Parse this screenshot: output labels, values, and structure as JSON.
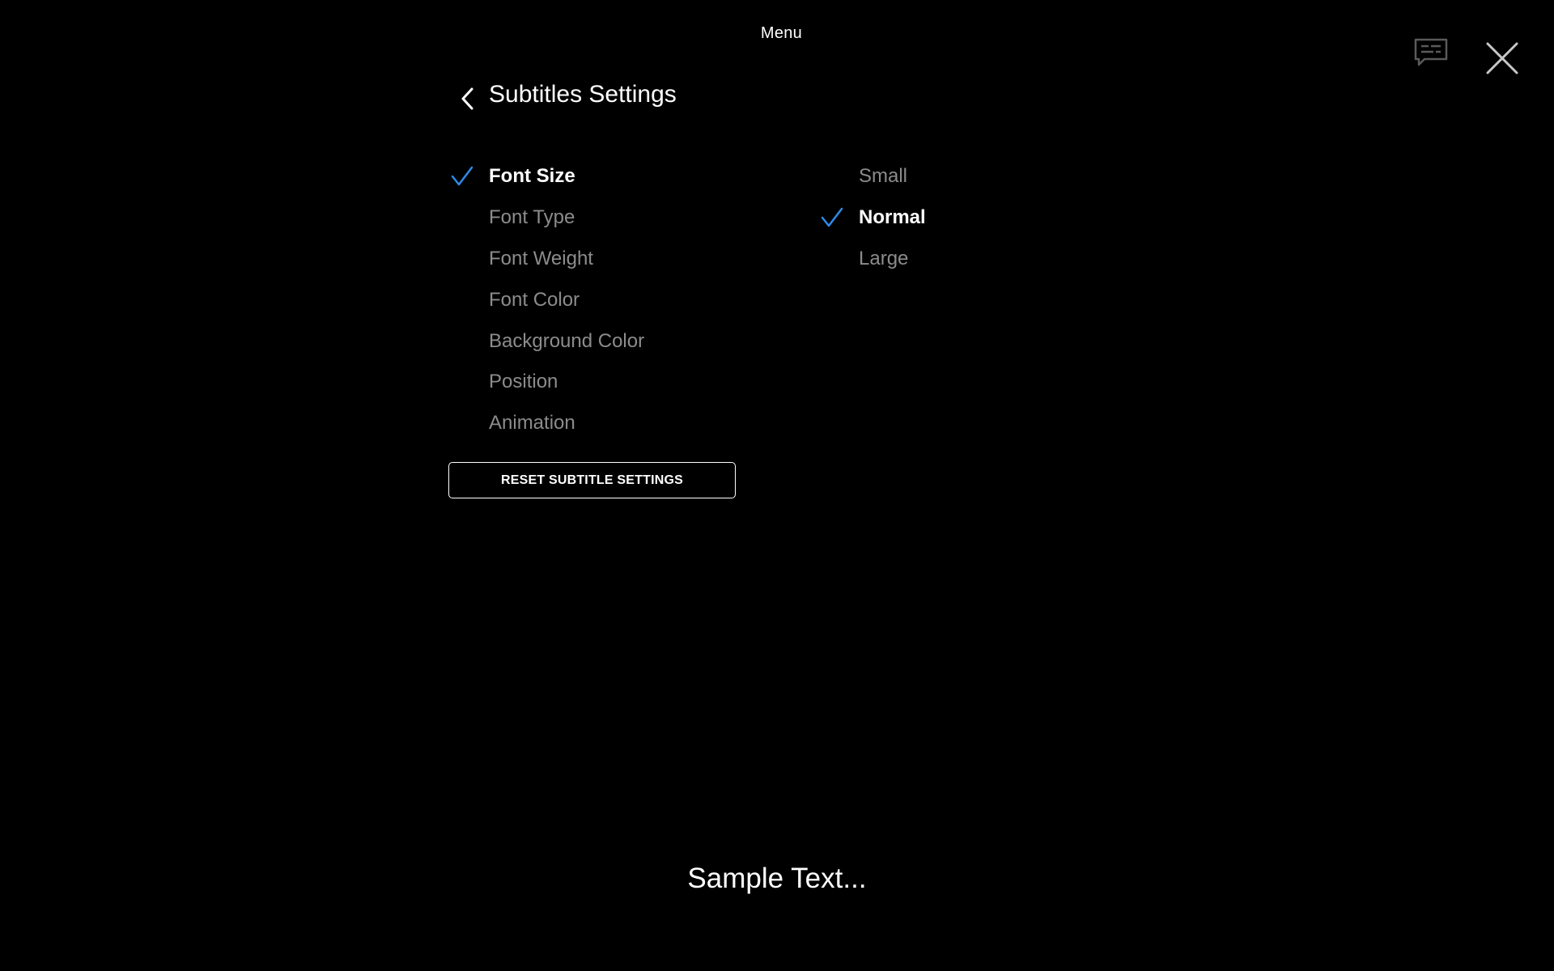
{
  "header": {
    "menu_title": "Menu",
    "subtitles_icon": "subtitles-icon",
    "close_icon": "close-icon"
  },
  "page": {
    "back_icon": "chevron-left-icon",
    "title": "Subtitles Settings"
  },
  "settings": {
    "selected_index": 0,
    "items": [
      {
        "label": "Font Size",
        "selected": true
      },
      {
        "label": "Font Type",
        "selected": false
      },
      {
        "label": "Font Weight",
        "selected": false
      },
      {
        "label": "Font Color",
        "selected": false
      },
      {
        "label": "Background Color",
        "selected": false
      },
      {
        "label": "Position",
        "selected": false
      },
      {
        "label": "Animation",
        "selected": false
      }
    ]
  },
  "options": {
    "selected_index": 1,
    "items": [
      {
        "label": "Small",
        "selected": false
      },
      {
        "label": "Normal",
        "selected": true
      },
      {
        "label": "Large",
        "selected": false
      }
    ]
  },
  "reset_button": {
    "label": "RESET SUBTITLE SETTINGS"
  },
  "preview": {
    "sample_text": "Sample Text..."
  },
  "colors": {
    "background": "#000000",
    "accent_check": "#2f8ae8",
    "text_selected": "#ffffff",
    "text_unselected": "#8c8c8c",
    "icon_muted": "#5a5a5a",
    "icon_close": "#c8c8c8"
  }
}
